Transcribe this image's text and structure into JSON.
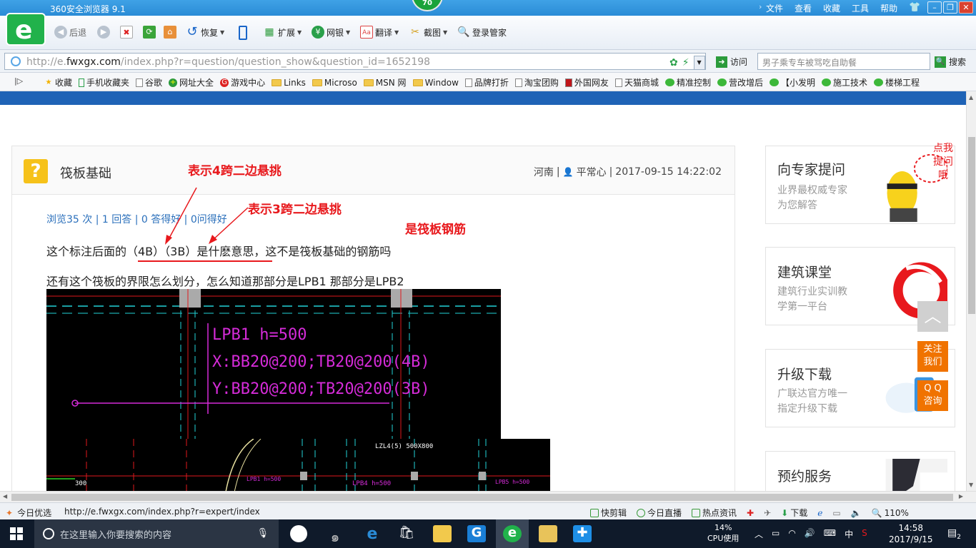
{
  "browser": {
    "title": "360安全浏览器 9.1",
    "badge": "70",
    "logo_letter": "e",
    "menu": [
      "文件",
      "查看",
      "收藏",
      "工具",
      "帮助"
    ],
    "toolbar": {
      "back": "后退",
      "restore": "恢复",
      "extend": "扩展",
      "bank": "网银",
      "translate": "翻译",
      "screenshot": "截图",
      "manager": "登录管家"
    },
    "address": {
      "prefix": "http://e.",
      "host": "fwxgx.com",
      "path": "/index.php?r=question/question_show&question_id=1652198",
      "go": "访问"
    },
    "search": {
      "placeholder": "男子乘专车被骂吃自助餐",
      "button": "搜索"
    },
    "bookmarks": [
      {
        "label": "收藏",
        "type": "star"
      },
      {
        "label": "手机收藏夹",
        "type": "phone"
      },
      {
        "label": "谷歌",
        "type": "page"
      },
      {
        "label": "网址大全",
        "type": "green"
      },
      {
        "label": "游戏中心",
        "type": "red"
      },
      {
        "label": "Links",
        "type": "folder"
      },
      {
        "label": "Microso",
        "type": "folder"
      },
      {
        "label": "MSN 网",
        "type": "folder"
      },
      {
        "label": "Window",
        "type": "folder"
      },
      {
        "label": "品牌打折",
        "type": "page"
      },
      {
        "label": "淘宝团购",
        "type": "page"
      },
      {
        "label": "外国网友",
        "type": "redpage"
      },
      {
        "label": "天猫商城",
        "type": "page"
      },
      {
        "label": "精准控制",
        "type": "wx"
      },
      {
        "label": "营改增后",
        "type": "wx"
      },
      {
        "label": "【小发明",
        "type": "wx"
      },
      {
        "label": "施工技术",
        "type": "wx"
      },
      {
        "label": "楼梯工程",
        "type": "wx"
      }
    ],
    "colors": {
      "accent": "#2a8bd6",
      "page_strip": "#1f63b6",
      "annotation": "#e8191d",
      "cad_text": "#d52bd8",
      "orange": "#f07300"
    }
  },
  "question": {
    "icon": "?",
    "title": "筏板基础",
    "region": "河南",
    "user": "平常心",
    "datetime": "2017-09-15 14:22:02",
    "stats": "浏览35 次 | 1 回答 | 0 答得好 | 0问得好",
    "line1": "这个标注后面的（4B）（3B）是什麽意思，这不是筏板基础的钢筋吗",
    "line2": "还有这个筏板的界限怎么划分，怎么知道那部分是LPB1 那部分是LPB2"
  },
  "annotations": {
    "a1": "表示4跨二边悬挑",
    "a2": "表示3跨二边悬挑",
    "a3": "是筏板钢筋"
  },
  "cad": {
    "line1": "LPB1  h=500",
    "line2": "X:BB20@200;TB20@200(4B)",
    "line3": "Y:BB20@200;TB20@200(3B)",
    "small1": "LZL4(5)  500X800",
    "small2": "LPB4  h=500",
    "small3": "LPB1  h=500",
    "small4": "LPB5  h=500",
    "left_label": "300"
  },
  "sidebar": {
    "ask": {
      "title": "向专家提问",
      "sub1": "业界最权威专家",
      "sub2": "为您解答",
      "bubble1": "点我",
      "bubble2": "提问哦"
    },
    "class": {
      "title": "建筑课堂",
      "sub1": "建筑行业实训教",
      "sub2": "学第一平台"
    },
    "upgrade": {
      "title": "升级下载",
      "sub1": "广联达官方唯一",
      "sub2": "指定升级下载"
    },
    "booking": {
      "title": "预约服务"
    },
    "float": {
      "follow1": "关注",
      "follow2": "我们",
      "qq1": "Q Q",
      "qq2": "咨询"
    }
  },
  "statusbar": {
    "left": "今日优选",
    "url": "http://e.fwxgx.com/index.php?r=expert/index",
    "items": [
      "快剪辑",
      "今日直播",
      "热点资讯",
      "下载"
    ],
    "zoom": "110%"
  },
  "taskbar": {
    "search_placeholder": "在这里输入你要搜索的内容",
    "cpu_pct": "14%",
    "cpu_label": "CPU使用",
    "ime": "中",
    "time": "14:58",
    "date": "2017/9/15",
    "notifications": "2"
  }
}
